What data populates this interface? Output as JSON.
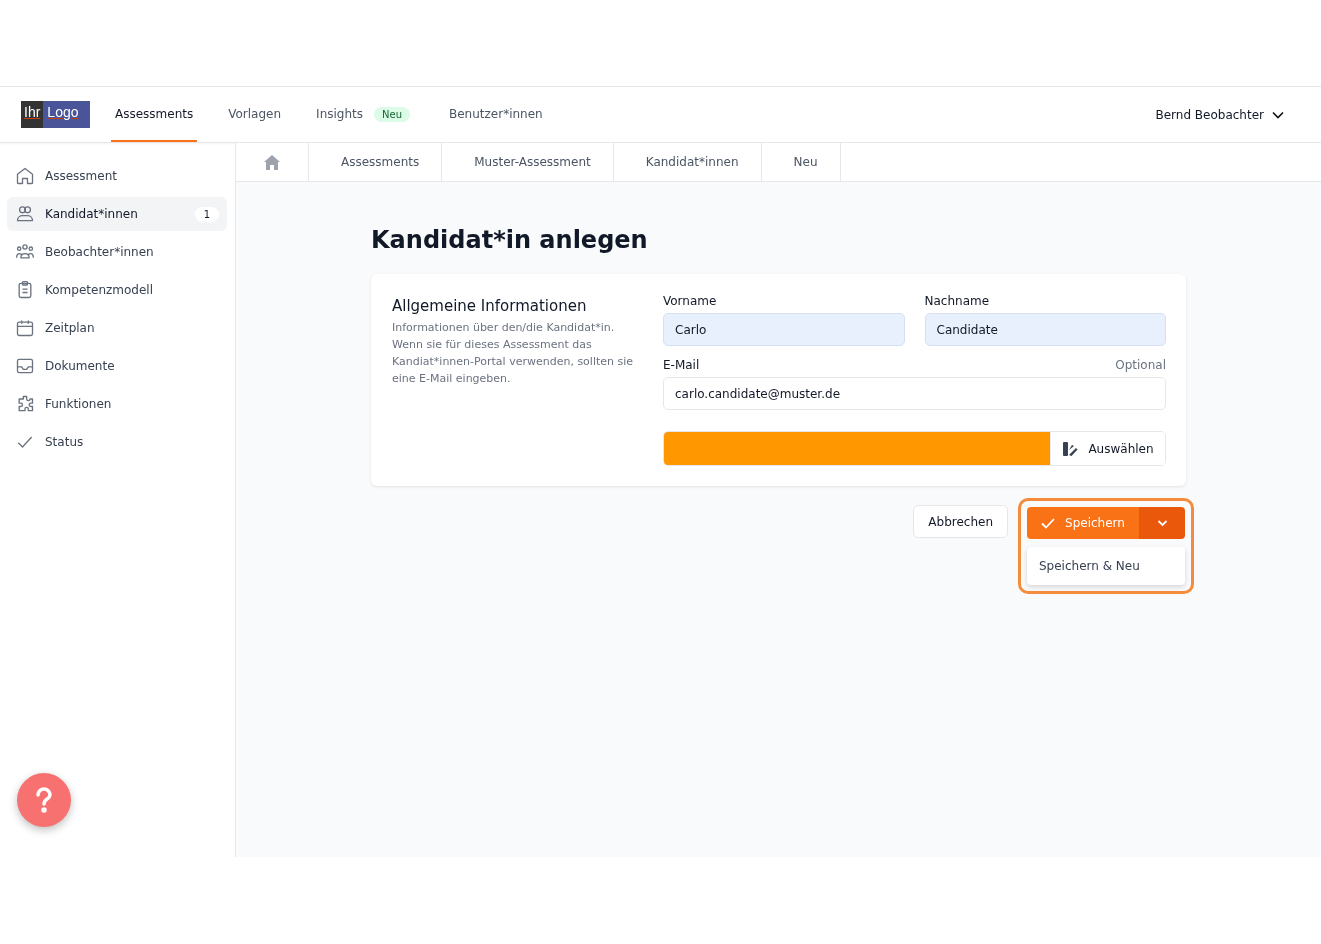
{
  "logo": {
    "left": "Ihr",
    "right": "Logo"
  },
  "nav": [
    {
      "label": "Assessments",
      "selected": true
    },
    {
      "label": "Vorlagen",
      "selected": false
    },
    {
      "label": "Insights",
      "selected": false,
      "badge": "Neu"
    },
    {
      "label": "Benutzer*innen",
      "selected": false
    }
  ],
  "user": "Bernd Beobachter",
  "sidebar": {
    "items": [
      {
        "label": "Assessment",
        "selected": false
      },
      {
        "label": "Kandidat*innen",
        "selected": true,
        "count": "1"
      },
      {
        "label": "Beobachter*innen",
        "selected": false
      },
      {
        "label": "Kompetenzmodell",
        "selected": false
      },
      {
        "label": "Zeitplan",
        "selected": false
      },
      {
        "label": "Dokumente",
        "selected": false
      },
      {
        "label": "Funktionen",
        "selected": false
      },
      {
        "label": "Status",
        "selected": false
      }
    ]
  },
  "breadcrumbs": [
    "Assessments",
    "Muster-Assessment",
    "Kandidat*innen",
    "Neu"
  ],
  "page_title": "Kandidat*in anlegen",
  "section": {
    "title": "Allgemeine Informationen",
    "description": "Informationen über den/die Kandidat*in. Wenn sie für dieses Assessment das Kandiat*innen-Portal verwenden, sollten sie eine E-Mail eingeben."
  },
  "fields": {
    "first_name": {
      "label": "Vorname",
      "value": "Carlo"
    },
    "last_name": {
      "label": "Nachname",
      "value": "Candidate"
    },
    "email": {
      "label": "E-Mail",
      "hint": "Optional",
      "value": "carlo.candidate@muster.de"
    }
  },
  "color_picker": {
    "color": "#ff9800",
    "button": "Auswählen"
  },
  "actions": {
    "cancel": "Abbrechen",
    "save": "Speichern",
    "menu_open": true,
    "menu": [
      "Speichern & Neu"
    ]
  }
}
